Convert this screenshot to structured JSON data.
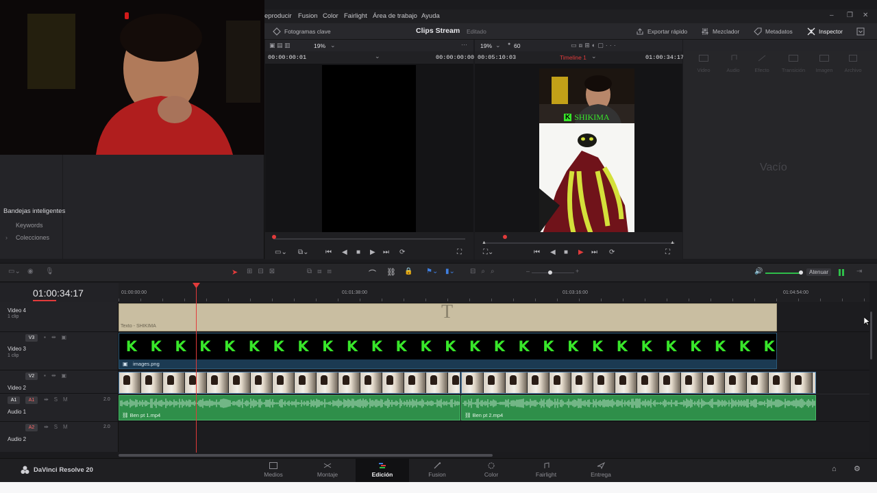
{
  "app": {
    "name": "DaVinci Resolve 20"
  },
  "menu": {
    "items": [
      "eproducir",
      "Fusion",
      "Color",
      "Fairlight",
      "Área de trabajo",
      "Ayuda"
    ]
  },
  "header": {
    "keyframes": "Fotogramas clave",
    "project_title": "Clips Stream",
    "project_status": "Editado",
    "export": "Exportar rápido",
    "mixer": "Mezclador",
    "metadata": "Metadatos",
    "inspector": "Inspector"
  },
  "source_viewer": {
    "zoom": "19%",
    "timecode_left": "00:00:00:01",
    "timecode_right": "00:00:00:00"
  },
  "timeline_viewer": {
    "zoom": "19%",
    "fps": "60",
    "timecode_left": "00:05:10:03",
    "timeline_name": "Timeline 1",
    "timecode_right": "01:00:34:17",
    "overlay_text": "SHIKIMA"
  },
  "inspector": {
    "tabs": [
      "Video",
      "Audio",
      "Efecto",
      "Transición",
      "Imagen",
      "Archivo"
    ],
    "empty": "Vacío"
  },
  "smart_bins": {
    "title": "Bandejas inteligentes",
    "items": [
      "Keywords",
      "Colecciones"
    ]
  },
  "edit_toolbar": {
    "volume_label": "Atenuar"
  },
  "timeline": {
    "timecode": "01:00:34:17",
    "ruler": [
      "01:00:00:00",
      "01:01:38:00",
      "01:03:16:00",
      "01:04:54:00"
    ],
    "tracks": [
      {
        "name": "Video 4",
        "sub": "1 clip",
        "badge": ""
      },
      {
        "name": "Video 3",
        "sub": "1 clip",
        "badge": "V3"
      },
      {
        "name": "Video 2",
        "sub": "",
        "badge": "V2"
      },
      {
        "name": "Audio 1",
        "sub": "",
        "badge": "A1",
        "level": "2.0"
      },
      {
        "name": "Audio 2",
        "sub": "",
        "badge": "A2",
        "level": "2.0"
      }
    ],
    "clips": {
      "title": "Texto - SHIKIMA",
      "image": "images.png",
      "audio1": "Ben pt 1.mp4",
      "audio2": "Ben pt 2.mp4"
    },
    "image_glyph": "K",
    "audio_track_labels": {
      "a1_left": "A1",
      "solo": "S",
      "mute": "M"
    }
  },
  "pages": [
    "Medios",
    "Montaje",
    "Edición",
    "Fusion",
    "Color",
    "Fairlight",
    "Entrega"
  ],
  "active_page": "Edición",
  "colors": {
    "accent": "#e23b3b",
    "video_clip": "#2d4a66",
    "audio_clip": "#2f8f4a",
    "title_clip": "#c9bea1",
    "image_glyph": "#38e62a"
  }
}
